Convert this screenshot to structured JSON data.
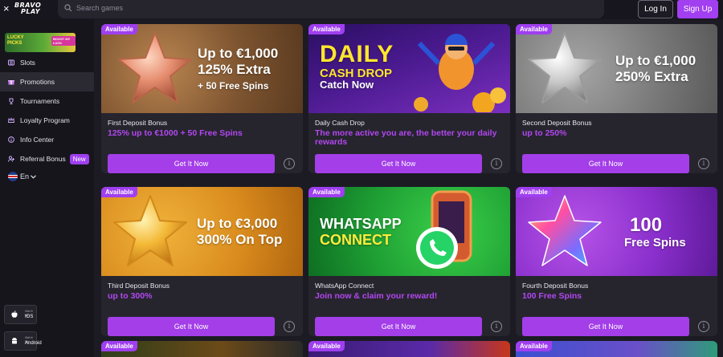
{
  "header": {
    "close": "×",
    "logo_line1": "BRAVO",
    "logo_line2": "PLAY",
    "search_placeholder": "Search games",
    "login": "Log In",
    "signup": "Sign Up"
  },
  "sidebar": {
    "promo": {
      "line1": "LUCKY",
      "line2": "PICKS",
      "badge": "BOOST MY LUCK"
    },
    "items": [
      {
        "label": "Slots",
        "icon": "slots-icon"
      },
      {
        "label": "Promotions",
        "icon": "gift-icon"
      },
      {
        "label": "Tournaments",
        "icon": "trophy-icon"
      },
      {
        "label": "Loyalty Program",
        "icon": "crown-icon"
      },
      {
        "label": "Info Center",
        "icon": "info-icon"
      },
      {
        "label": "Referral Bonus",
        "icon": "referral-icon",
        "badge": "New"
      }
    ],
    "language": "En",
    "stores": [
      {
        "small": "Get it for",
        "name": "IOS"
      },
      {
        "small": "Get it for",
        "name": "Android"
      }
    ]
  },
  "cards": [
    {
      "badge": "Available",
      "banner": [
        "Up to €1,000",
        "125% Extra",
        "+ 50 Free Spins"
      ],
      "title": "First Deposit Bonus",
      "subtitle": "125% up to €1000 + 50 Free Spins",
      "button": "Get It Now"
    },
    {
      "badge": "Available",
      "banner": [
        "DAILY",
        "CASH DROP",
        "Catch Now"
      ],
      "title": "Daily Cash Drop",
      "subtitle": "The more active you are, the better your daily rewards",
      "button": "Get It Now"
    },
    {
      "badge": "Available",
      "banner": [
        "Up to €1,000",
        "250% Extra"
      ],
      "title": "Second Deposit Bonus",
      "subtitle": "up to 250%",
      "button": "Get It Now"
    },
    {
      "badge": "Available",
      "banner": [
        "Up to €3,000",
        "300% On Top"
      ],
      "title": "Third Deposit Bonus",
      "subtitle": "up to 300%",
      "button": "Get It Now"
    },
    {
      "badge": "Available",
      "banner": [
        "WHATSAPP",
        "CONNECT"
      ],
      "title": "WhatsApp Connect",
      "subtitle": "Join now & claim your reward!",
      "button": "Get It Now"
    },
    {
      "badge": "Available",
      "banner": [
        "100",
        "Free Spins"
      ],
      "title": "Fourth Deposit Bonus",
      "subtitle": "100 Free Spins",
      "button": "Get It Now"
    }
  ],
  "row3": [
    {
      "badge": "Available"
    },
    {
      "badge": "Available"
    },
    {
      "badge": "Available"
    }
  ],
  "colors": {
    "accent": "#a33ee8",
    "bg": "#1c1b24",
    "card": "#26252e",
    "sidebar": "#16151c"
  }
}
